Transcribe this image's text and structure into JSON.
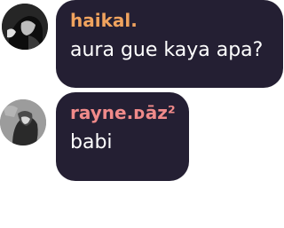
{
  "messages": [
    {
      "author": "haikal.",
      "author_color": "#f0a35e",
      "text": "aura gue kaya apa?"
    },
    {
      "author": "rayne.ᴅāz²",
      "author_color": "#f08a8a",
      "text": "babi"
    }
  ],
  "colors": {
    "bubble_bg": "#241f33",
    "message_text": "#ffffff"
  },
  "icons": {
    "avatar_1": "user-avatar-photo-dark",
    "avatar_2": "user-avatar-photo-gray"
  }
}
